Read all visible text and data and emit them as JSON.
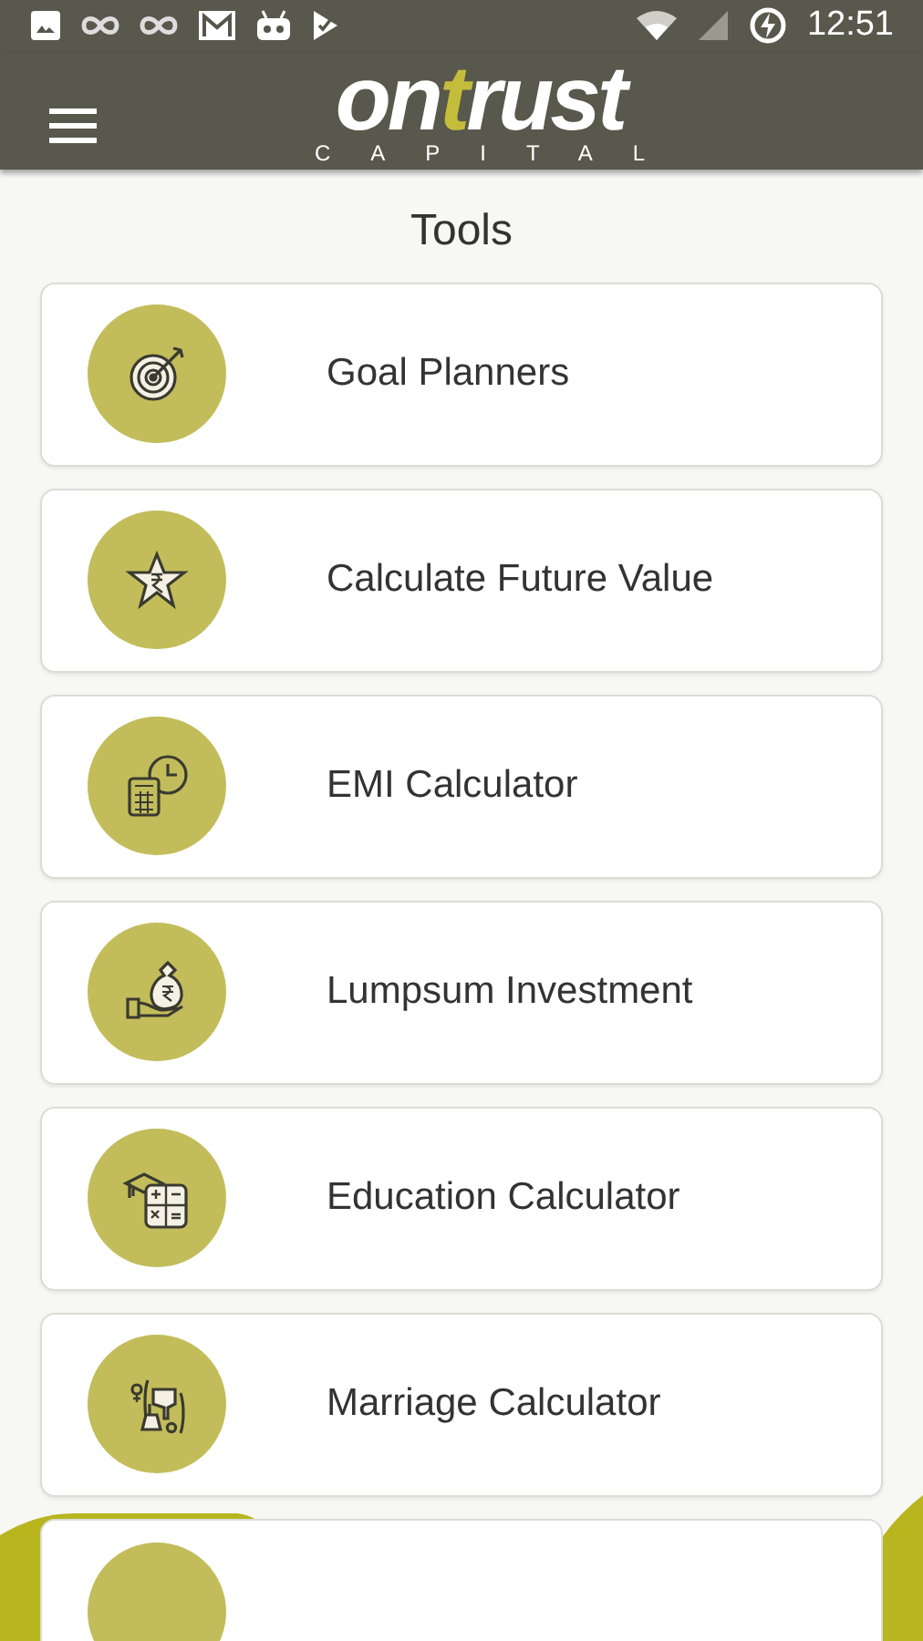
{
  "status_bar": {
    "time": "12:51"
  },
  "app_bar": {
    "logo": {
      "part_1": "on",
      "accent": "t",
      "part_2": "rust",
      "tagline": "CAPITAL"
    }
  },
  "title": "Tools",
  "tools": [
    {
      "label": "Goal Planners",
      "kind": "target"
    },
    {
      "label": "Calculate Future Value",
      "kind": "star"
    },
    {
      "label": "EMI Calculator",
      "kind": "calculator-clock"
    },
    {
      "label": "Lumpsum Investment",
      "kind": "money-bag"
    },
    {
      "label": "Education Calculator",
      "kind": "education"
    },
    {
      "label": "Marriage Calculator",
      "kind": "marriage"
    }
  ],
  "more_below": true
}
